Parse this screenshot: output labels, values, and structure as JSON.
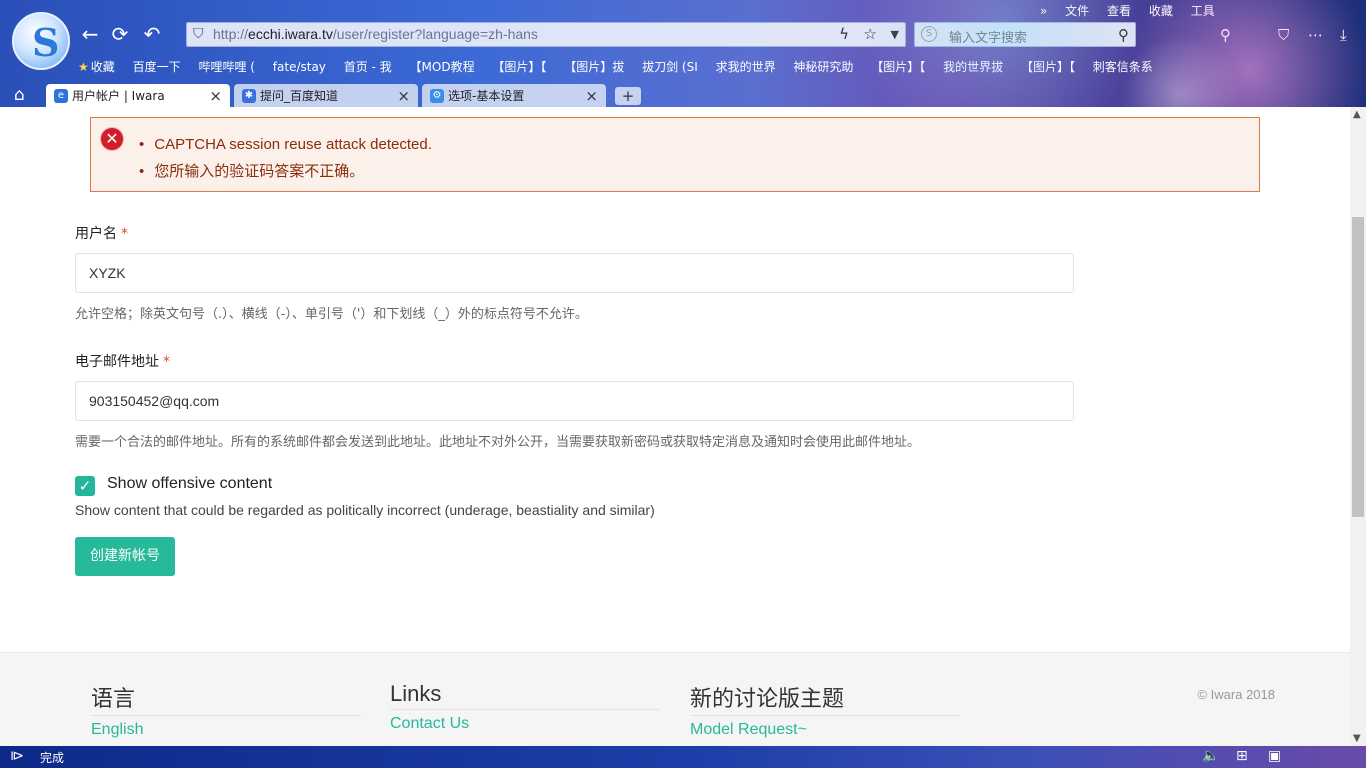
{
  "browser": {
    "address_prefix": "http://",
    "address_domain": "ecchi.iwara.tv",
    "address_path": "/user/register?language=zh-hans",
    "search_placeholder": "输入文字搜索",
    "top_menu": [
      "文件",
      "查看",
      "收藏",
      "工具"
    ],
    "bookmarks": [
      "收藏",
      "百度一下",
      "哔哩哔哩 (",
      "fate/stay",
      "首页 - 我",
      "【MOD教程",
      "【图片】【",
      "【图片】拔",
      "拔刀剑 (SI",
      "求我的世界",
      "神秘研究助",
      "【图片】【",
      "我的世界拔",
      "【图片】【",
      "刺客信条系"
    ],
    "tabs": [
      {
        "title": "用户帐户 | Iwara",
        "active": true
      },
      {
        "title": "提问_百度知道",
        "active": false
      },
      {
        "title": "选项-基本设置",
        "active": false
      }
    ],
    "status_text": "完成"
  },
  "alert": {
    "messages": [
      "CAPTCHA session reuse attack detected.",
      "您所输入的验证码答案不正确。"
    ]
  },
  "form": {
    "username_label": "用户名",
    "username_value": "XYZK",
    "username_help": "允许空格；除英文句号（.）、横线（-）、单引号（'）和下划线（_）外的标点符号不允许。",
    "email_label": "电子邮件地址",
    "email_value": "903150452@qq.com",
    "email_help": "需要一个合法的邮件地址。所有的系统邮件都会发送到此地址。此地址不对外公开，当需要获取新密码或获取特定消息及通知时会使用此邮件地址。",
    "required_mark": "*",
    "offensive_label": "Show offensive content",
    "offensive_checked": true,
    "offensive_desc": "Show content that could be regarded as politically incorrect (underage, beastiality and similar)",
    "submit_label": "创建新帐号"
  },
  "footer": {
    "col1_title": "语言",
    "col1_link": "English",
    "col2_title": "Links",
    "col2_link": "Contact Us",
    "col3_title": "新的讨论版主题",
    "col3_link": "Model Request~",
    "copyright": "© Iwara 2018"
  }
}
